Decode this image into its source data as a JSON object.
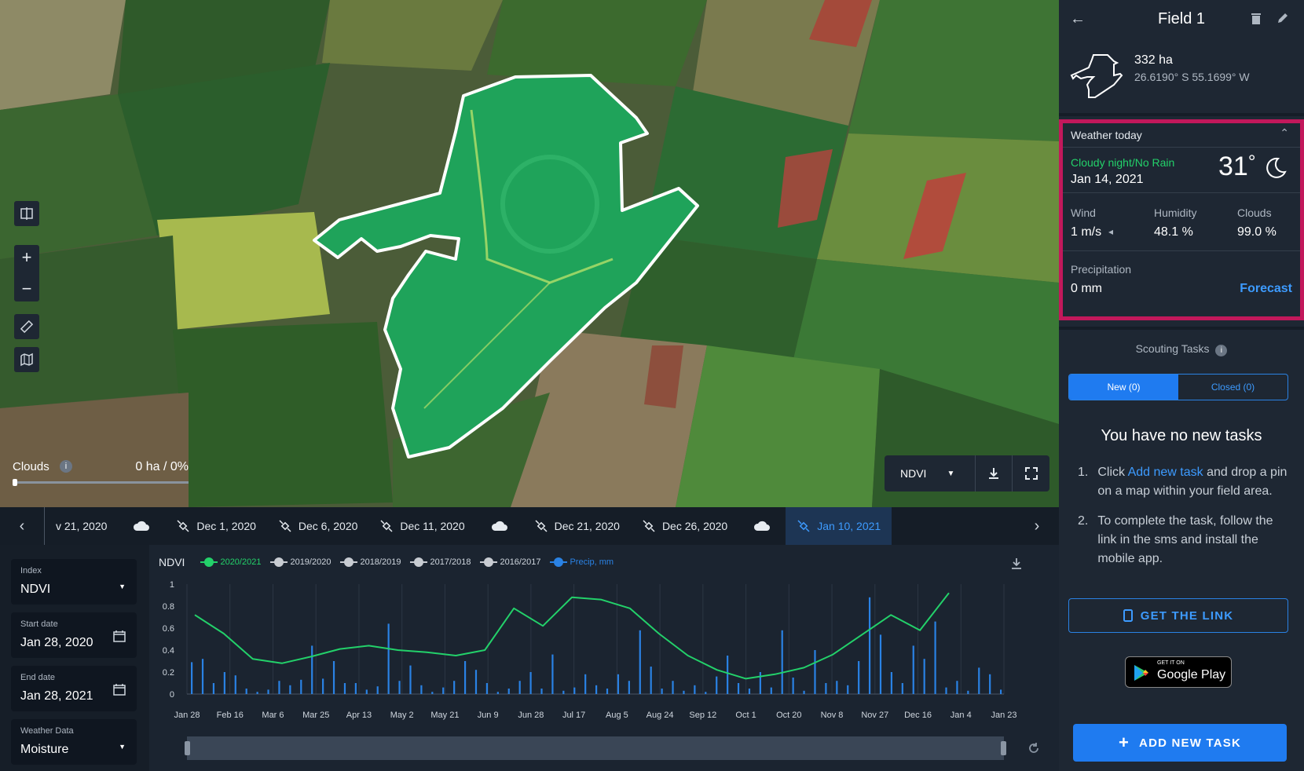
{
  "map": {
    "clouds_label": "Clouds",
    "clouds_value": "0 ha / 0%",
    "layer": "NDVI"
  },
  "timeline": {
    "items": [
      {
        "label": "v 21, 2020",
        "type": "date"
      },
      {
        "label": "",
        "type": "cloud"
      },
      {
        "label": "Dec 1, 2020",
        "type": "date"
      },
      {
        "label": "Dec 6, 2020",
        "type": "date"
      },
      {
        "label": "Dec 11, 2020",
        "type": "date"
      },
      {
        "label": "",
        "type": "cloud"
      },
      {
        "label": "Dec 21, 2020",
        "type": "date"
      },
      {
        "label": "Dec 26, 2020",
        "type": "date"
      },
      {
        "label": "",
        "type": "cloud"
      },
      {
        "label": "Jan 10, 2021",
        "type": "date",
        "selected": true
      }
    ]
  },
  "filters": {
    "index_label": "Index",
    "index_value": "NDVI",
    "start_label": "Start date",
    "start_value": "Jan 28, 2020",
    "end_label": "End date",
    "end_value": "Jan 28, 2021",
    "weather_label": "Weather Data",
    "weather_value": "Moisture"
  },
  "chart_legend": {
    "title": "NDVI",
    "items": [
      {
        "label": "2020/2021",
        "color": "#23d16a"
      },
      {
        "label": "2019/2020",
        "color": "#c8ccd2"
      },
      {
        "label": "2018/2019",
        "color": "#c8ccd2"
      },
      {
        "label": "2017/2018",
        "color": "#c8ccd2"
      },
      {
        "label": "2016/2017",
        "color": "#c8ccd2"
      },
      {
        "label": "Precip, mm",
        "color": "#2a82e4"
      }
    ]
  },
  "chart_data": {
    "type": "line",
    "title": "",
    "ylim": [
      0,
      1
    ],
    "yticks": [
      "0",
      "0.2",
      "0.4",
      "0.6",
      "0.8",
      "1"
    ],
    "x": [
      "Jan 28",
      "Feb 16",
      "Mar 6",
      "Mar 25",
      "Apr 13",
      "May 2",
      "May 21",
      "Jun 9",
      "Jun 28",
      "Jul 17",
      "Aug 5",
      "Aug 24",
      "Sep 12",
      "Oct 1",
      "Oct 20",
      "Nov 8",
      "Nov 27",
      "Dec 16",
      "Jan 4",
      "Jan 23"
    ],
    "series": [
      {
        "name": "2020/2021",
        "color": "#23d16a",
        "values": [
          0.72,
          0.55,
          0.32,
          0.28,
          0.34,
          0.41,
          0.44,
          0.4,
          0.38,
          0.35,
          0.4,
          0.78,
          0.62,
          0.88,
          0.86,
          0.78,
          0.55,
          0.35,
          0.22,
          0.14,
          0.18,
          0.24,
          0.36,
          0.54,
          0.72,
          0.58,
          0.92
        ]
      },
      {
        "name": "Precip, mm",
        "color": "#2a82e4",
        "values": [
          0.29,
          0.32,
          0.1,
          0.2,
          0.17,
          0.05,
          0.02,
          0.04,
          0.12,
          0.08,
          0.13,
          0.44,
          0.14,
          0.3,
          0.1,
          0.1,
          0.04,
          0.07,
          0.64,
          0.12,
          0.26,
          0.08,
          0.02,
          0.06,
          0.12,
          0.3,
          0.22,
          0.1,
          0.02,
          0.05,
          0.12,
          0.2,
          0.05,
          0.36,
          0.03,
          0.06,
          0.18,
          0.08,
          0.05,
          0.18,
          0.12,
          0.58,
          0.25,
          0.05,
          0.12,
          0.03,
          0.08,
          0.02,
          0.16,
          0.35,
          0.1,
          0.05,
          0.2,
          0.06,
          0.58,
          0.15,
          0.03,
          0.4,
          0.1,
          0.12,
          0.08,
          0.3,
          0.88,
          0.54,
          0.2,
          0.1,
          0.44,
          0.32,
          0.66,
          0.06,
          0.12,
          0.03,
          0.24,
          0.18,
          0.04
        ]
      }
    ],
    "grid": true,
    "legend": "top-left"
  },
  "sidebar": {
    "title": "Field 1",
    "area": "332 ha",
    "coords": "26.6190° S 55.1699° W",
    "weather": {
      "header": "Weather today",
      "condition": "Cloudy night/No Rain",
      "date": "Jan 14, 2021",
      "temp": "31",
      "deg": "°",
      "wind_label": "Wind",
      "wind_value": "1 m/s",
      "humidity_label": "Humidity",
      "humidity_value": "48.1 %",
      "clouds_label": "Clouds",
      "clouds_value": "99.0 %",
      "precip_label": "Precipitation",
      "precip_value": "0 mm",
      "forecast": "Forecast"
    },
    "scouting_title": "Scouting Tasks",
    "tab_new": "New (0)",
    "tab_closed": "Closed (0)",
    "empty_title": "You have no new tasks",
    "step1_num": "1.",
    "step1_pre": "Click ",
    "step1_link": "Add new task",
    "step1_post": " and drop a pin on a map within your field area.",
    "step2_num": "2.",
    "step2_text": "To complete the task, follow the link in the sms and install the mobile app.",
    "get_link": "GET THE LINK",
    "gplay_small": "GET IT ON",
    "gplay_big": "Google Play",
    "add_task": "ADD NEW TASK"
  }
}
